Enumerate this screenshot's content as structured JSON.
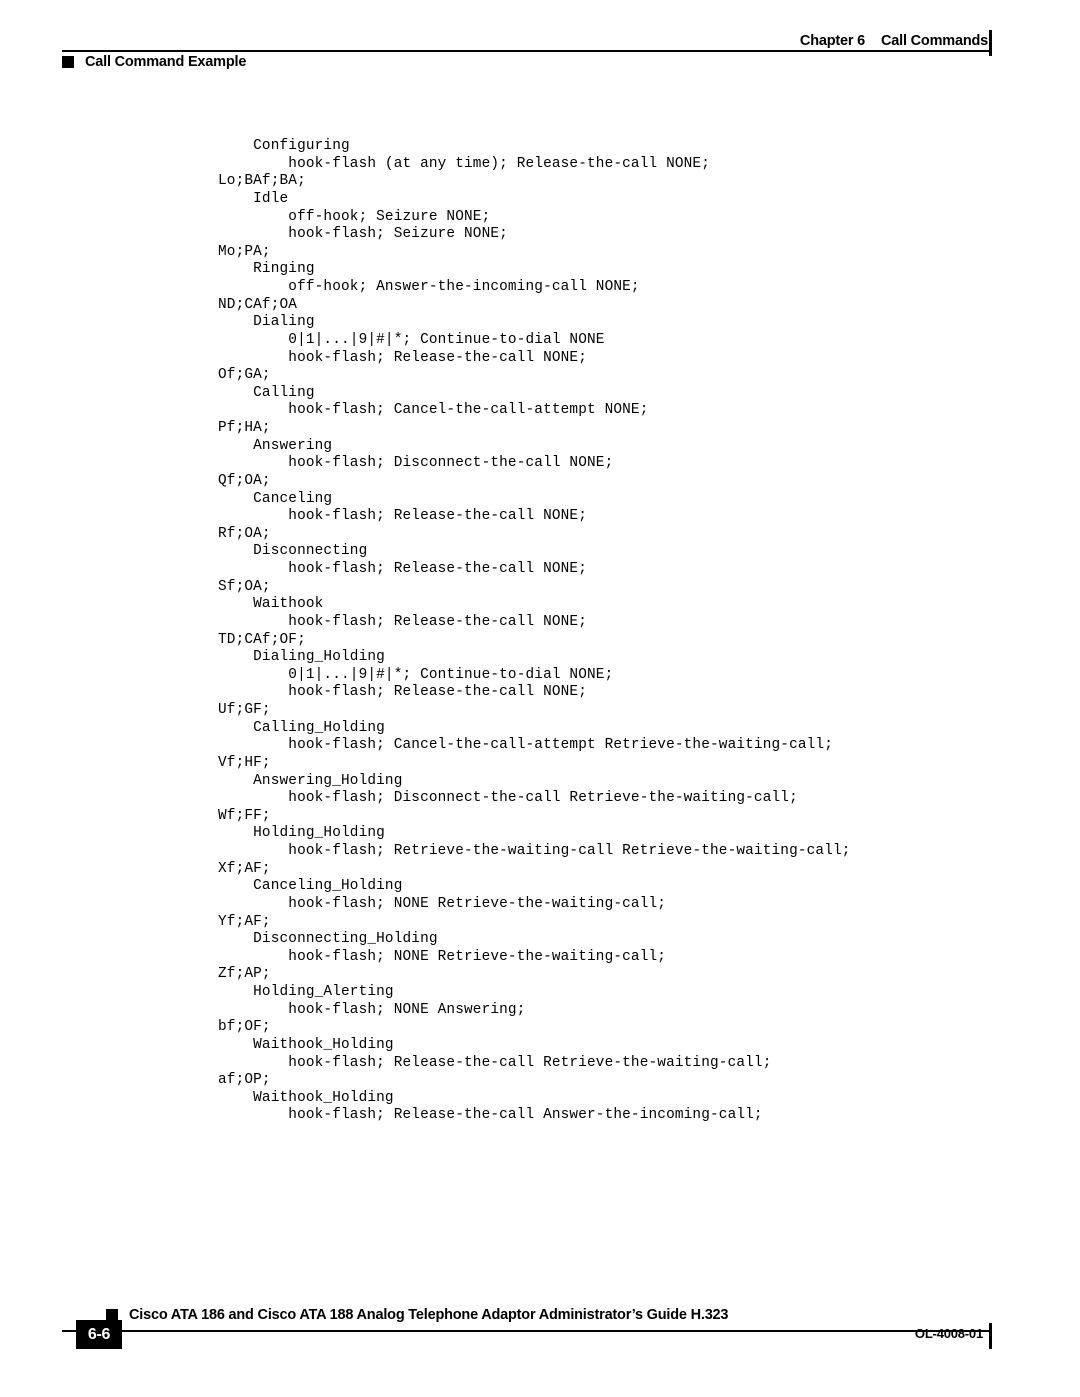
{
  "header": {
    "chapter_label": "Chapter 6",
    "chapter_title": "Call Commands",
    "section_title": "Call Command Example"
  },
  "code": {
    "lines": [
      "    Configuring",
      "        hook-flash (at any time); Release-the-call NONE;",
      "Lo;BAf;BA;",
      "    Idle",
      "        off-hook; Seizure NONE;",
      "        hook-flash; Seizure NONE;",
      "Mo;PA;",
      "    Ringing",
      "        off-hook; Answer-the-incoming-call NONE;",
      "ND;CAf;OA",
      "    Dialing",
      "        0|1|...|9|#|*; Continue-to-dial NONE",
      "        hook-flash; Release-the-call NONE;",
      "Of;GA;",
      "    Calling",
      "        hook-flash; Cancel-the-call-attempt NONE;",
      "Pf;HA;",
      "    Answering",
      "        hook-flash; Disconnect-the-call NONE;",
      "Qf;OA;",
      "    Canceling",
      "        hook-flash; Release-the-call NONE;",
      "Rf;OA;",
      "    Disconnecting",
      "        hook-flash; Release-the-call NONE;",
      "Sf;OA;",
      "    Waithook",
      "        hook-flash; Release-the-call NONE;",
      "TD;CAf;OF;",
      "    Dialing_Holding",
      "        0|1|...|9|#|*; Continue-to-dial NONE;",
      "        hook-flash; Release-the-call NONE;",
      "Uf;GF;",
      "    Calling_Holding",
      "        hook-flash; Cancel-the-call-attempt Retrieve-the-waiting-call;",
      "Vf;HF;",
      "    Answering_Holding",
      "        hook-flash; Disconnect-the-call Retrieve-the-waiting-call;",
      "Wf;FF;",
      "    Holding_Holding",
      "        hook-flash; Retrieve-the-waiting-call Retrieve-the-waiting-call;",
      "Xf;AF;",
      "    Canceling_Holding",
      "        hook-flash; NONE Retrieve-the-waiting-call;",
      "Yf;AF;",
      "    Disconnecting_Holding",
      "        hook-flash; NONE Retrieve-the-waiting-call;",
      "Zf;AP;",
      "    Holding_Alerting",
      "        hook-flash; NONE Answering;",
      "bf;OF;",
      "    Waithook_Holding",
      "        hook-flash; Release-the-call Retrieve-the-waiting-call;",
      "af;OP;",
      "    Waithook_Holding",
      "        hook-flash; Release-the-call Answer-the-incoming-call;"
    ]
  },
  "footer": {
    "guide_title": "Cisco ATA 186 and Cisco ATA 188 Analog Telephone Adaptor Administrator’s Guide H.323",
    "page_number": "6-6",
    "document_id": "OL-4008-01"
  },
  "colors": {
    "ink": "#000000",
    "paper": "#ffffff",
    "pagenum_text": "#ffffff"
  }
}
